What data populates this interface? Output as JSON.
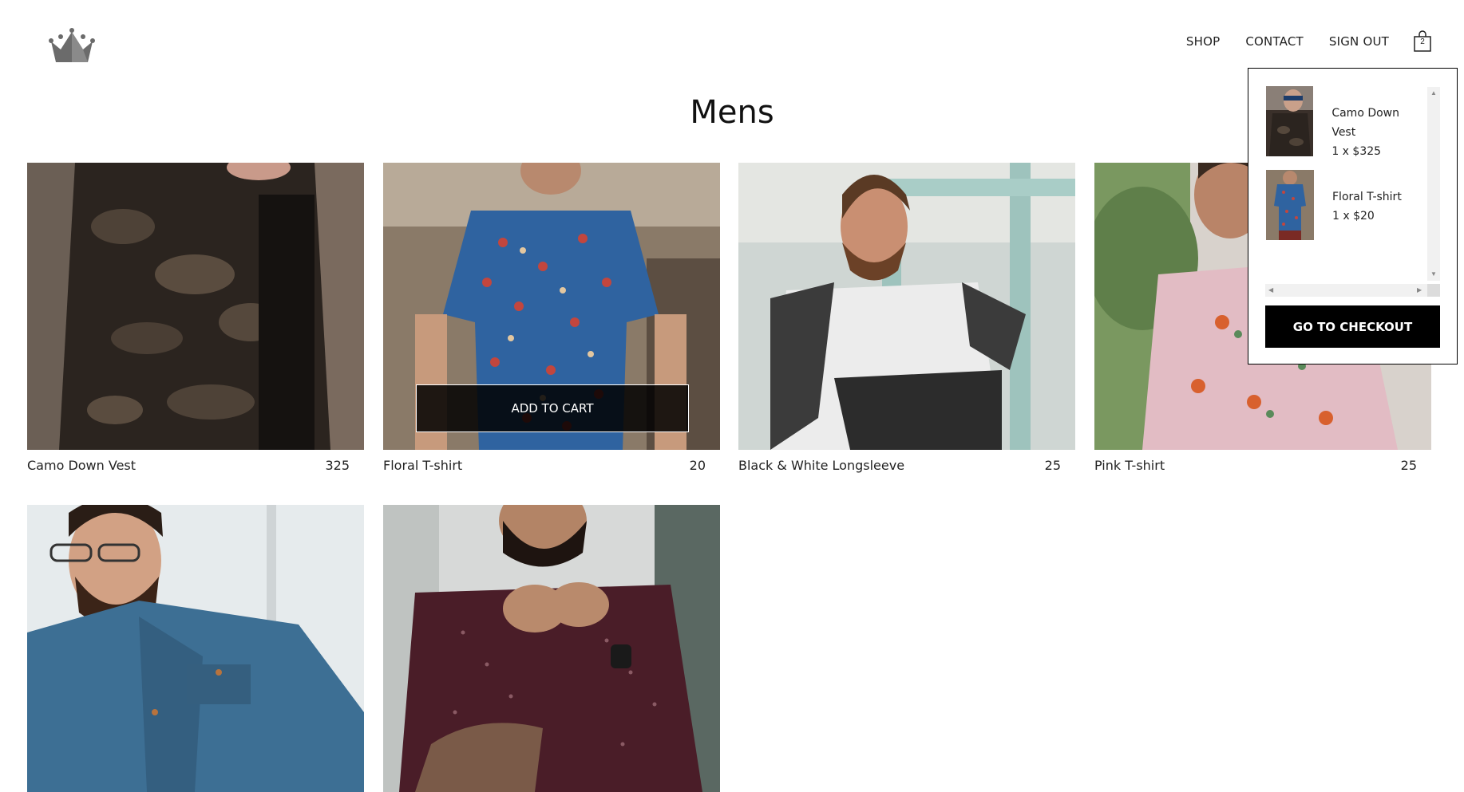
{
  "nav": {
    "shop_label": "SHOP",
    "contact_label": "CONTACT",
    "signout_label": "SIGN OUT",
    "cart_count": "2"
  },
  "page": {
    "title": "Mens"
  },
  "products": [
    {
      "name": "Camo Down Vest",
      "price": "325"
    },
    {
      "name": "Floral T-shirt",
      "price": "20",
      "add_to_cart_label": "ADD TO CART"
    },
    {
      "name": "Black & White Longsleeve",
      "price": "25"
    },
    {
      "name": "Pink T-shirt",
      "price": "25"
    },
    {
      "name": "",
      "price": ""
    },
    {
      "name": "",
      "price": ""
    }
  ],
  "cart": {
    "items": [
      {
        "name": "Camo Down Vest",
        "qty_price": "1 x $325"
      },
      {
        "name": "Floral T-shirt",
        "qty_price": "1 x $20"
      }
    ],
    "checkout_label": "GO TO CHECKOUT"
  },
  "icons": {
    "logo": "crown-icon",
    "cart": "shopping-bag-icon"
  }
}
